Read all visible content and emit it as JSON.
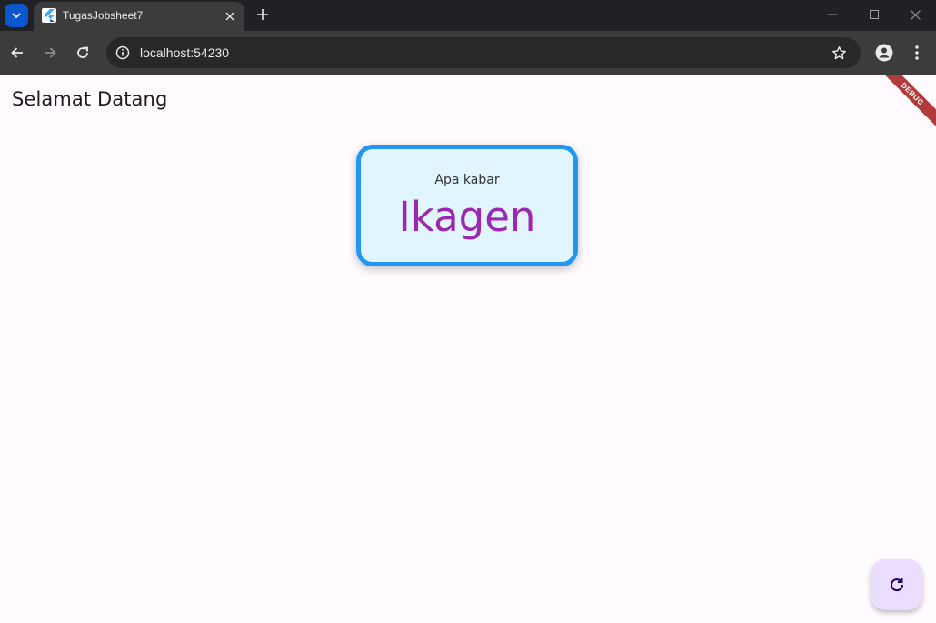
{
  "browser": {
    "tab_title": "TugasJobsheet7",
    "url": "localhost:54230"
  },
  "page": {
    "title": "Selamat Datang",
    "debug_banner": "DEBUG",
    "card": {
      "greeting": "Apa kabar",
      "name": "Ikagen"
    }
  },
  "icons": {
    "tab_search": "chevron-down-icon",
    "favicon": "flutter-icon",
    "close": "close-icon",
    "new_tab": "plus-icon",
    "back": "arrow-left-icon",
    "forward": "arrow-right-icon",
    "reload": "reload-icon",
    "site_info": "info-icon",
    "bookmark": "star-icon",
    "profile": "profile-icon",
    "menu": "kebab-menu-icon",
    "fab": "refresh-icon"
  },
  "colors": {
    "card_border": "#2196f3",
    "card_background": "#e1f5fe",
    "name_text": "#9c27b0",
    "fab_background": "#eaddff",
    "page_background": "#fffbff"
  }
}
